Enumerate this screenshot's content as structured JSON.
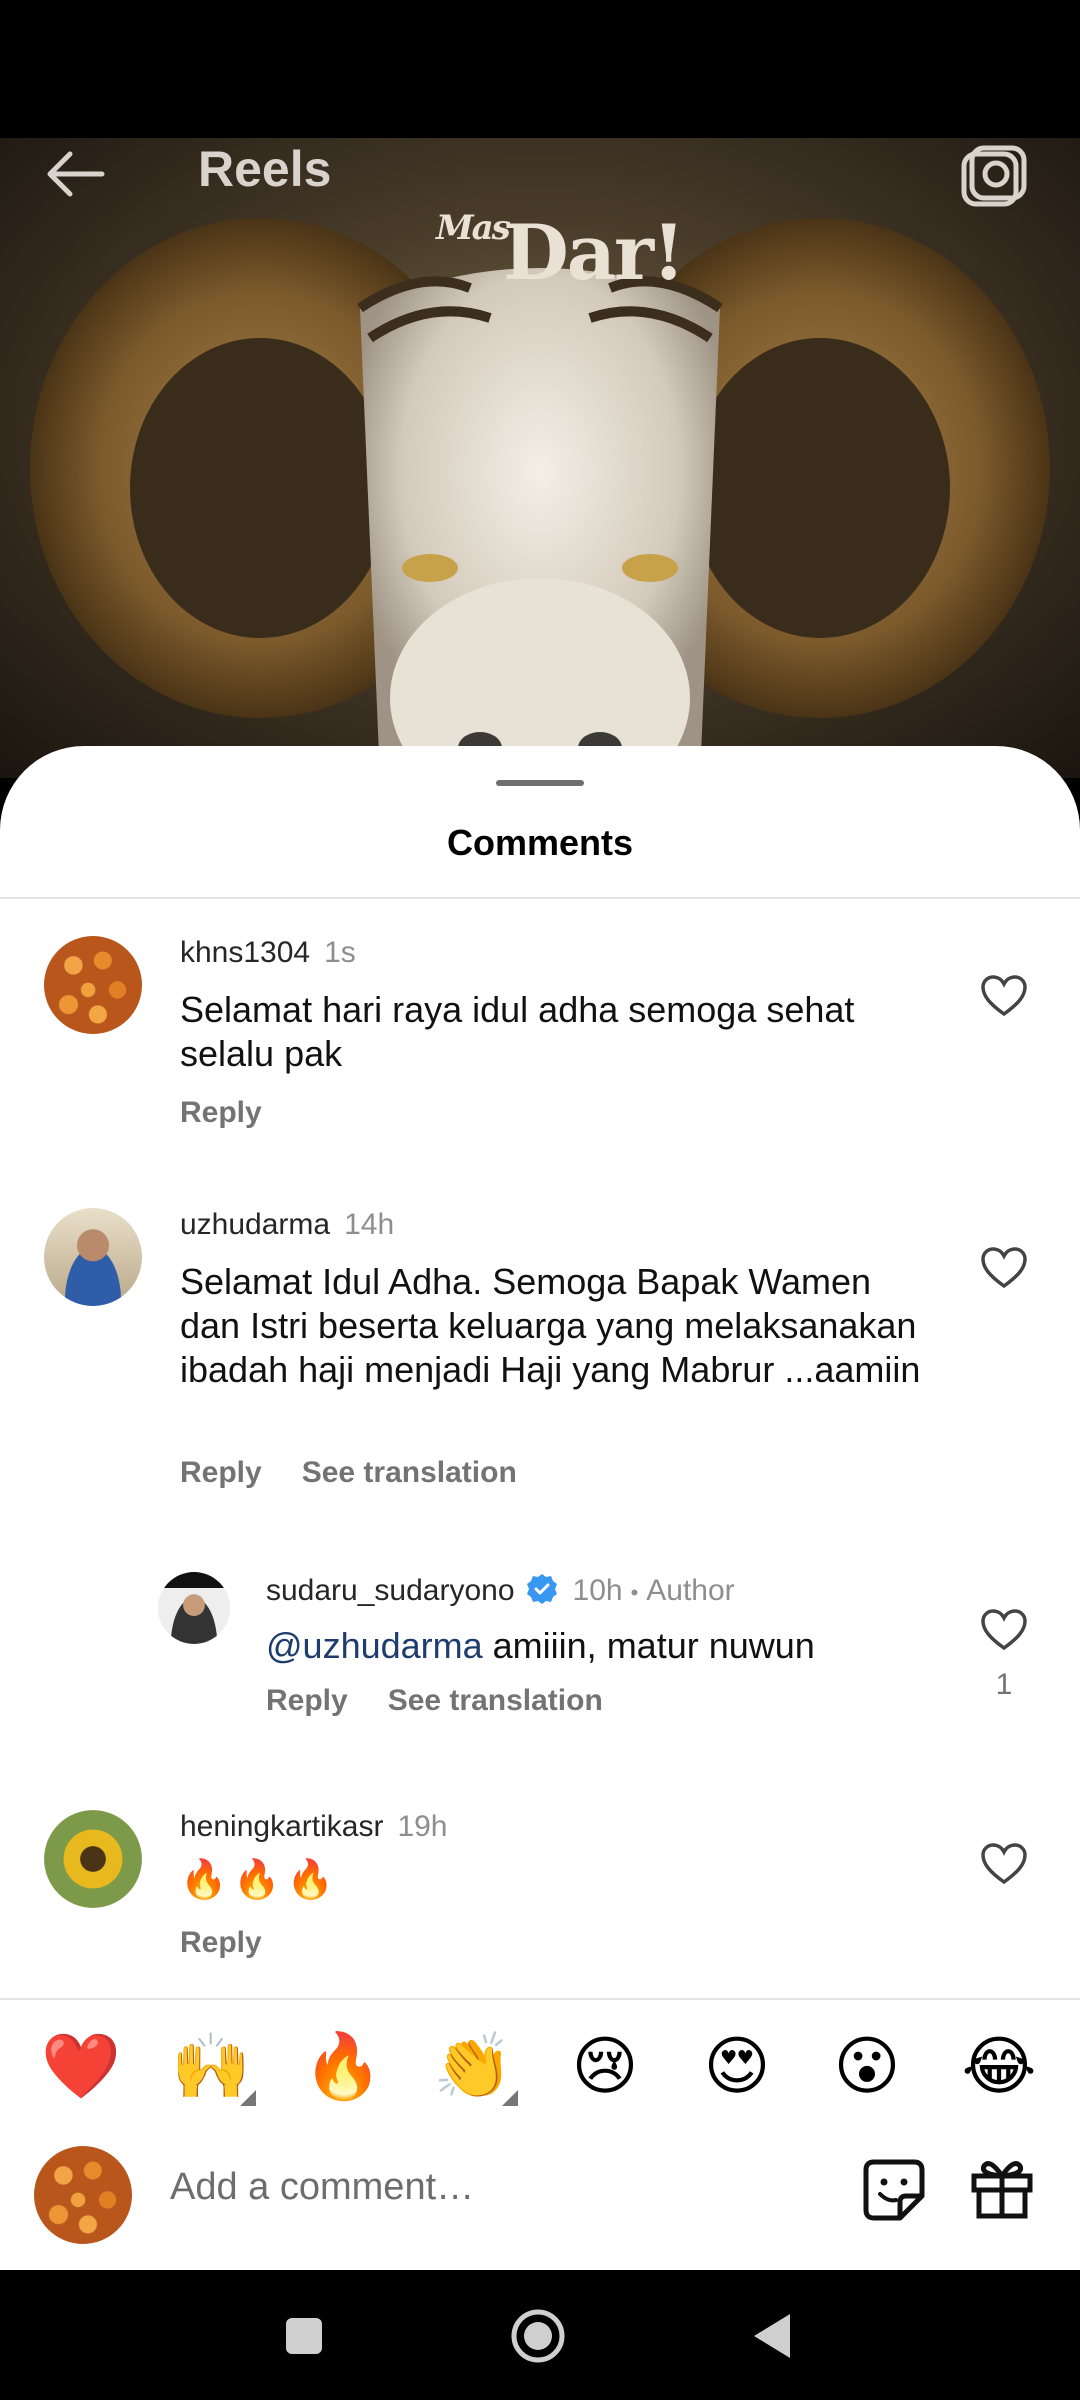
{
  "header": {
    "title": "Reels",
    "brand_text": "Dar!",
    "brand_prefix": "Mas"
  },
  "sheet": {
    "title": "Comments"
  },
  "comments": [
    {
      "username": "khns1304",
      "time": "1s",
      "text": "Selamat hari raya idul adha semoga sehat selalu pak",
      "reply_label": "Reply"
    },
    {
      "username": "uzhudarma",
      "time": "14h",
      "text": "Selamat Idul Adha. Semoga Bapak Wamen dan Istri beserta keluarga yang melaksanakan ibadah haji menjadi Haji yang Mabrur ...aamiin",
      "reply_label": "Reply",
      "translation_label": "See translation"
    },
    {
      "username": "sudaru_sudaryono",
      "time": "10h",
      "author_tag": "Author",
      "mention": "@uzhudarma",
      "text": " amiiin, matur nuwun",
      "reply_label": "Reply",
      "translation_label": "See translation",
      "likes": "1"
    },
    {
      "username": "heningkartikasr",
      "time": "19h",
      "text": "🔥🔥🔥",
      "reply_label": "Reply"
    }
  ],
  "emoji_bar": [
    "❤️",
    "🙌",
    "🔥",
    "👏",
    "😢",
    "😍",
    "😮",
    "😂"
  ],
  "composer": {
    "placeholder": "Add a comment…"
  },
  "colors": {
    "accent_verified": "#3897f0",
    "mention": "#1e3d6e"
  }
}
